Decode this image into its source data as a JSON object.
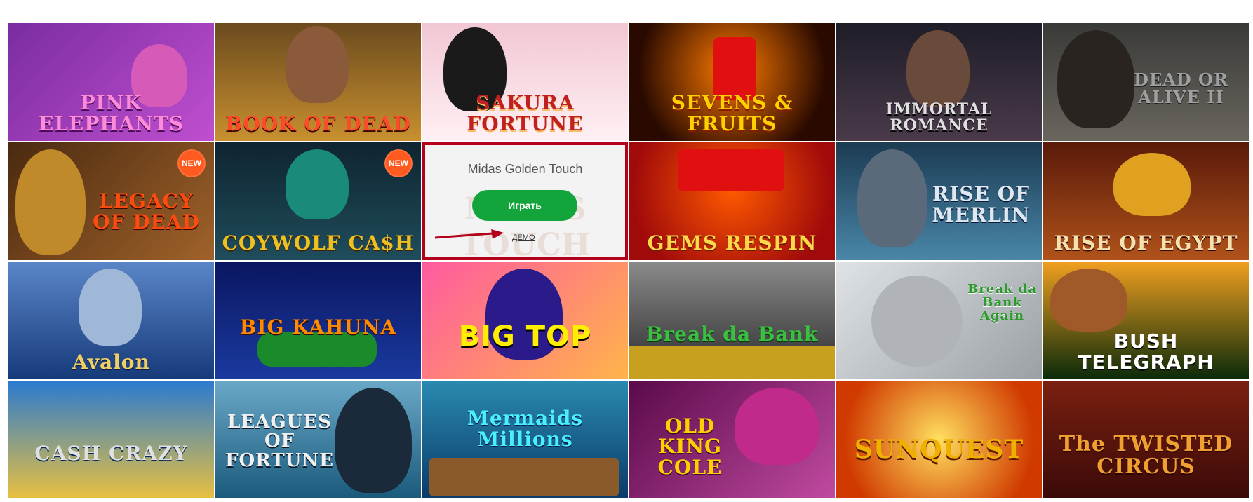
{
  "games": [
    {
      "id": "pink-elephants",
      "title": "PINK ELEPHANTS",
      "bg": "#7a2ca0",
      "bg2": "#c04fd0",
      "new": false
    },
    {
      "id": "book-of-dead",
      "title": "BOOK OF DEAD",
      "bg": "#6b4a1e",
      "bg2": "#c8902f",
      "new": false
    },
    {
      "id": "sakura-fortune",
      "title": "SAKURA FORTUNE",
      "bg": "#f1c7d3",
      "bg2": "#fff0f4",
      "new": false
    },
    {
      "id": "sevens-fruits",
      "title": "SEVENS & FRUITS",
      "bg": "#2a0a00",
      "bg2": "#c43a00",
      "new": false
    },
    {
      "id": "immortal-romance",
      "title": "IMMORTAL ROMANCE",
      "bg": "#1e1d27",
      "bg2": "#4a3a4a",
      "new": false
    },
    {
      "id": "dead-or-alive-2",
      "title": "DEAD OR ALIVE II",
      "bg": "#3a3a38",
      "bg2": "#6a665e",
      "new": false
    },
    {
      "id": "legacy-of-dead",
      "title": "LEGACY OF DEAD",
      "bg": "#4a2a10",
      "bg2": "#a0622a",
      "new": true
    },
    {
      "id": "coywolf-cash",
      "title": "COYWOLF CA$H",
      "bg": "#0f2430",
      "bg2": "#1f4d5c",
      "new": true
    },
    {
      "id": "midas-golden-touch",
      "title": "",
      "bg": "#f3f3f3",
      "bg2": "#f3f3f3",
      "new": false,
      "hover": true
    },
    {
      "id": "777-gems-respin",
      "title": "GEMS RESPIN",
      "bg": "#c20a0a",
      "bg2": "#ff5a00",
      "new": false
    },
    {
      "id": "rise-of-merlin",
      "title": "RISE OF MERLIN",
      "bg": "#1b3b52",
      "bg2": "#4a86a8",
      "new": false
    },
    {
      "id": "rise-of-egypt",
      "title": "RISE OF EGYPT",
      "bg": "#5a1a0a",
      "bg2": "#b0521a",
      "new": false
    },
    {
      "id": "avalon",
      "title": "Avalon",
      "bg": "#163a7a",
      "bg2": "#5a86c8",
      "new": false
    },
    {
      "id": "big-kahuna",
      "title": "BIG KAHUNA",
      "bg": "#0a1660",
      "bg2": "#1a3aa0",
      "new": false
    },
    {
      "id": "big-top",
      "title": "BIG TOP",
      "bg": "#ff5aa0",
      "bg2": "#ffb44a",
      "new": false
    },
    {
      "id": "break-da-bank",
      "title": "Break da Bank",
      "bg": "#2a2a2a",
      "bg2": "#8a8a8a",
      "new": false
    },
    {
      "id": "break-da-bank-again",
      "title": "Break da Bank Again",
      "bg": "#9aa0a4",
      "bg2": "#dfe3e6",
      "new": false
    },
    {
      "id": "bush-telegraph",
      "title": "BUSH TELEGRAPH",
      "bg": "#0a2a0a",
      "bg2": "#f0a020",
      "new": false
    },
    {
      "id": "cash-crazy",
      "title": "CASH CRAZY",
      "bg": "#2a7ad0",
      "bg2": "#e8c040",
      "new": false
    },
    {
      "id": "leagues-of-fortune",
      "title": "LEAGUES OF FORTUNE",
      "bg": "#1a5a7a",
      "bg2": "#6aa8c8",
      "new": false
    },
    {
      "id": "mermaids-millions",
      "title": "Mermaids Millions",
      "bg": "#0a3a6a",
      "bg2": "#2a8ab0",
      "new": false
    },
    {
      "id": "old-king-cole",
      "title": "OLD KING COLE",
      "bg": "#5a0a4a",
      "bg2": "#c04aa0",
      "new": false
    },
    {
      "id": "sunquest",
      "title": "SUNQUEST",
      "bg": "#d03a00",
      "bg2": "#ffc000",
      "new": false
    },
    {
      "id": "the-twisted-circus",
      "title": "The TWISTED CIRCUS",
      "bg": "#3a0a08",
      "bg2": "#7a2010",
      "new": false
    }
  ],
  "hover": {
    "game_name": "Midas Golden Touch",
    "play_label": "Играть",
    "demo_label": "ДЕМО",
    "faint_logo": "MIDAS TOUCH"
  },
  "labels": {
    "new_badge": "NEW"
  },
  "colors": {
    "play_button": "#13a53c",
    "hover_border": "#b3001b",
    "arrow": "#b3001b"
  }
}
